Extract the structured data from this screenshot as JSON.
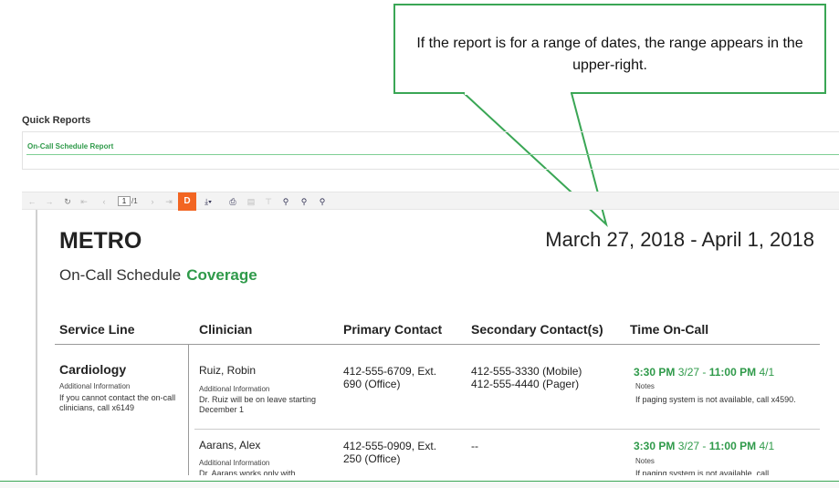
{
  "callout": {
    "text": "If the report is for a range of dates, the range appears in the upper-right."
  },
  "quick_reports": {
    "title": "Quick Reports",
    "tab_label": "On-Call Schedule Report"
  },
  "toolbar": {
    "page_value": "1",
    "page_total": "/1",
    "pdf_label": "D"
  },
  "report": {
    "org": "METRO",
    "date_range": "March 27, 2018 - April 1, 2018",
    "subtitle": "On-Call Schedule",
    "subtitle_accent": "Coverage",
    "columns": [
      "Service Line",
      "Clinician",
      "Primary Contact",
      "Secondary Contact(s)",
      "Time On-Call"
    ],
    "service_line": {
      "name": "Cardiology",
      "info_label": "Additional Information",
      "info": "If you cannot contact the on-call clinicians, call x6149"
    },
    "rows": [
      {
        "clinician": "Ruiz, Robin",
        "info_label": "Additional Information",
        "info": "Dr. Ruiz will be on leave starting December 1",
        "primary": "412-555-6709, Ext. 690 (Office)",
        "secondary_1": "412-555-3330 (Mobile)",
        "secondary_2": "412-555-4440 (Pager)",
        "start_time": "3:30 PM",
        "start_date": "3/27",
        "sep": "-",
        "end_time": "11:00 PM",
        "end_date": "4/1",
        "notes_label": "Notes",
        "notes": "If paging system is not available, call x4590."
      },
      {
        "clinician": "Aarans, Alex",
        "info_label": "Additional Information",
        "info": "Dr. Aarans works only with",
        "primary": "412-555-0909, Ext. 250 (Office)",
        "secondary_1": "--",
        "secondary_2": "",
        "start_time": "3:30 PM",
        "start_date": "3/27",
        "sep": "-",
        "end_time": "11:00 PM",
        "end_date": "4/1",
        "notes_label": "Notes",
        "notes": "If paging system is not available, call"
      }
    ]
  },
  "colors": {
    "accent_green": "#2f9a4a",
    "callout_border": "#3aa655",
    "pdf_orange": "#f26522"
  }
}
